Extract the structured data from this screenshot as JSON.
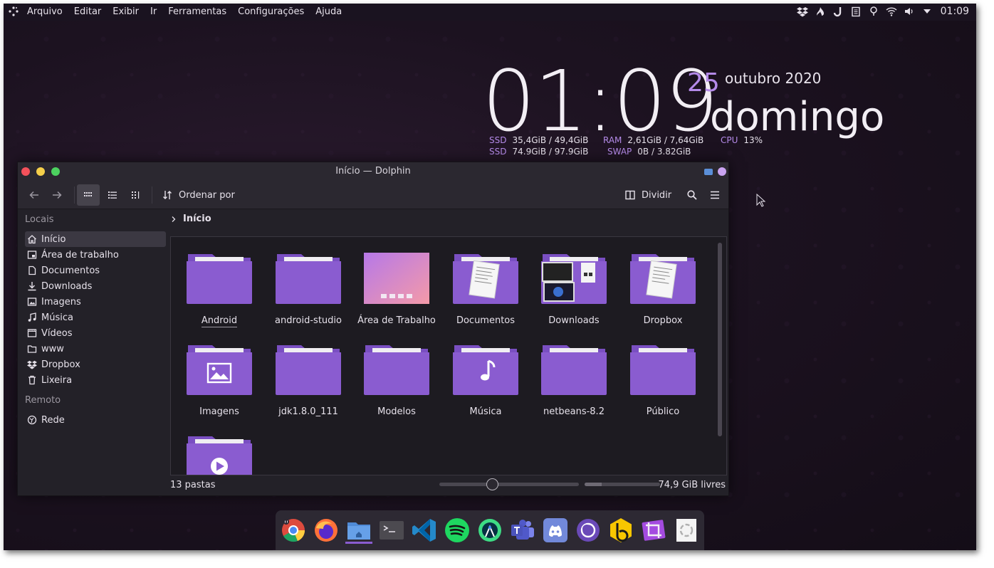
{
  "topbar": {
    "menu": [
      "Arquivo",
      "Editar",
      "Exibir",
      "Ir",
      "Ferramentas",
      "Configurações",
      "Ajuda"
    ],
    "clock": "01:09",
    "tray_icons": [
      "dropbox-icon",
      "steam-icon",
      "jetbrains-toolbox-icon",
      "clipboard-icon",
      "notifications-icon",
      "wifi-icon",
      "volume-icon",
      "expand-icon"
    ]
  },
  "widget": {
    "time": "01:09",
    "day": "25",
    "month_year": "outubro 2020",
    "weekday": "domingo",
    "stats": {
      "ssd1_label": "SSD",
      "ssd1_value": "35,4GiB / 49,4GiB",
      "ssd2_label": "SSD",
      "ssd2_value": "74.9GiB / 97.9GiB",
      "ram_label": "RAM",
      "ram_value": "2,61GiB / 7,64GiB",
      "swap_label": "SWAP",
      "swap_value": "0B / 3.82GiB",
      "cpu_label": "CPU",
      "cpu_value": "13%"
    }
  },
  "window": {
    "title": "Início — Dolphin",
    "colors": {
      "close": "#f4515b",
      "minimize": "#f5cf4a",
      "maximize": "#4cd15f"
    },
    "toolbar": {
      "sort_label": "Ordenar por",
      "split_label": "Dividir"
    },
    "sidebar": {
      "places_header": "Locais",
      "places": [
        {
          "label": "Início",
          "icon": "home-icon"
        },
        {
          "label": "Área de trabalho",
          "icon": "desktop-icon"
        },
        {
          "label": "Documentos",
          "icon": "document-icon"
        },
        {
          "label": "Downloads",
          "icon": "download-icon"
        },
        {
          "label": "Imagens",
          "icon": "image-icon"
        },
        {
          "label": "Música",
          "icon": "music-icon"
        },
        {
          "label": "Vídeos",
          "icon": "video-icon"
        },
        {
          "label": "www",
          "icon": "folder-icon"
        },
        {
          "label": "Dropbox",
          "icon": "dropbox-icon"
        },
        {
          "label": "Lixeira",
          "icon": "trash-icon"
        }
      ],
      "remote_header": "Remoto",
      "remote": [
        {
          "label": "Rede",
          "icon": "network-icon"
        }
      ]
    },
    "breadcrumb": "Início",
    "folders": [
      {
        "name": "Android",
        "overlay": "none"
      },
      {
        "name": "android-studio",
        "overlay": "none"
      },
      {
        "name": "Área de Trabalho",
        "overlay": "desktop"
      },
      {
        "name": "Documentos",
        "overlay": "document"
      },
      {
        "name": "Downloads",
        "overlay": "downloads"
      },
      {
        "name": "Dropbox",
        "overlay": "document"
      },
      {
        "name": "Imagens",
        "overlay": "image"
      },
      {
        "name": "jdk1.8.0_111",
        "overlay": "none"
      },
      {
        "name": "Modelos",
        "overlay": "none"
      },
      {
        "name": "Música",
        "overlay": "music"
      },
      {
        "name": "netbeans-8.2",
        "overlay": "none"
      },
      {
        "name": "Público",
        "overlay": "none"
      },
      {
        "name": "",
        "overlay": "video"
      }
    ],
    "status": {
      "count": "13 pastas",
      "free": "74,9 GiB livres",
      "zoom_fraction": 0.38,
      "disk_used_fraction": 0.23
    }
  },
  "dock": {
    "apps": [
      "chrome-icon",
      "firefox-icon",
      "dolphin-icon",
      "terminal-icon",
      "vscode-icon",
      "spotify-icon",
      "android-studio-icon",
      "teams-icon",
      "discord-icon",
      "plasma-icon",
      "bitwarden-icon",
      "crop-icon",
      "trash-dock-icon"
    ]
  },
  "accent": "#8a5cd0"
}
